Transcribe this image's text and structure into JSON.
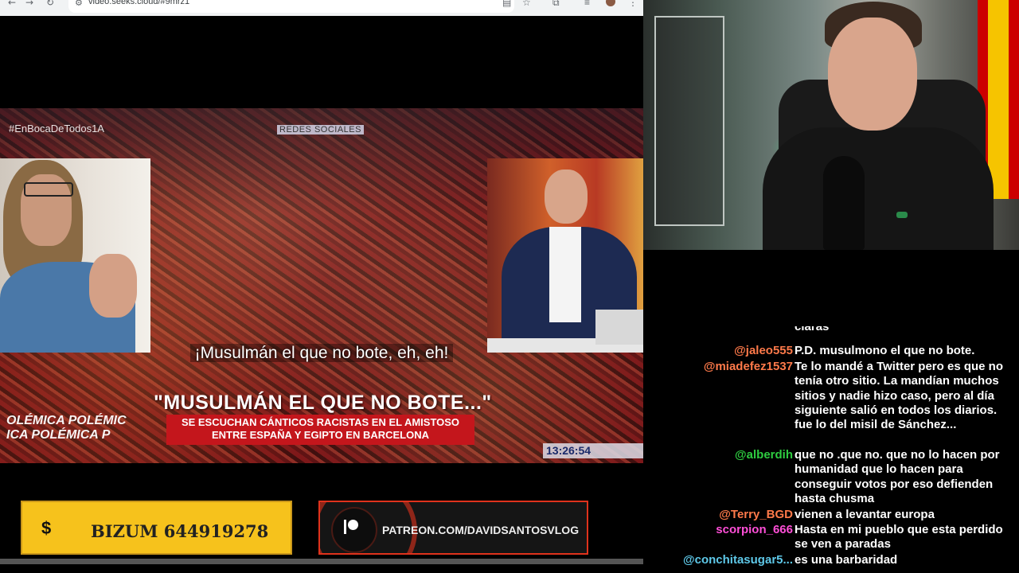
{
  "browser": {
    "url": "video.seeks.cloud/#9mrz1",
    "back_icon": "arrow-left-icon",
    "forward_icon": "arrow-right-icon",
    "reload_icon": "reload-icon"
  },
  "video": {
    "hashtag": "#EnBocaDeTodos1A",
    "source_label": "REDES SOCIALES",
    "subtitle": "¡Musulmán el que no bote, eh, eh!",
    "headline": "\"MUSULMÁN EL QUE NO BOTE...\"",
    "subheadline_line1": "SE ESCUCHAN CÁNTICOS RACISTAS EN EL AMISTOSO",
    "subheadline_line2": "ENTRE ESPAÑA Y EGIPTO EN BARCELONA",
    "polemica_1": "OLÉMICA   POLÉMIC",
    "polemica_2": "ICA   POLÉMICA   P",
    "clock": "13:26:54"
  },
  "banners": {
    "bizum_symbol": "$",
    "bizum_text": "BIZUM 644919278",
    "patreon_text": "PATREON.COM/DAVIDSANTOSVLOG"
  },
  "chat": {
    "partial_top": "claras",
    "messages": [
      {
        "user": "@jaleo555",
        "color": "#ff7a4a",
        "text": "P.D. musulmono el que no bote."
      },
      {
        "user": "@miadefez1537",
        "color": "#ff7a4a",
        "text": "Te lo mandé a Twitter pero es que no tenía otro sitio. La mandían muchos sitios y nadie hizo caso, pero al día siguiente salió en todos los diarios. fue lo del misil de Sánchez..."
      },
      {
        "user": "@alberdih",
        "color": "#2ecc40",
        "text": "que no .que no. que no lo hacen por humanidad que lo hacen para conseguir votos por eso defienden hasta chusma"
      },
      {
        "user": "@Terry_BGD",
        "color": "#ff7a4a",
        "text": "vienen a levantar europa"
      },
      {
        "user": "scorpion_666",
        "color": "#ff4fd8",
        "text": "Hasta en mi pueblo que esta perdido se ven a paradas"
      },
      {
        "user": "@conchitasugar5...",
        "color": "#5ec8e8",
        "text": "es una barbaridad"
      }
    ]
  }
}
